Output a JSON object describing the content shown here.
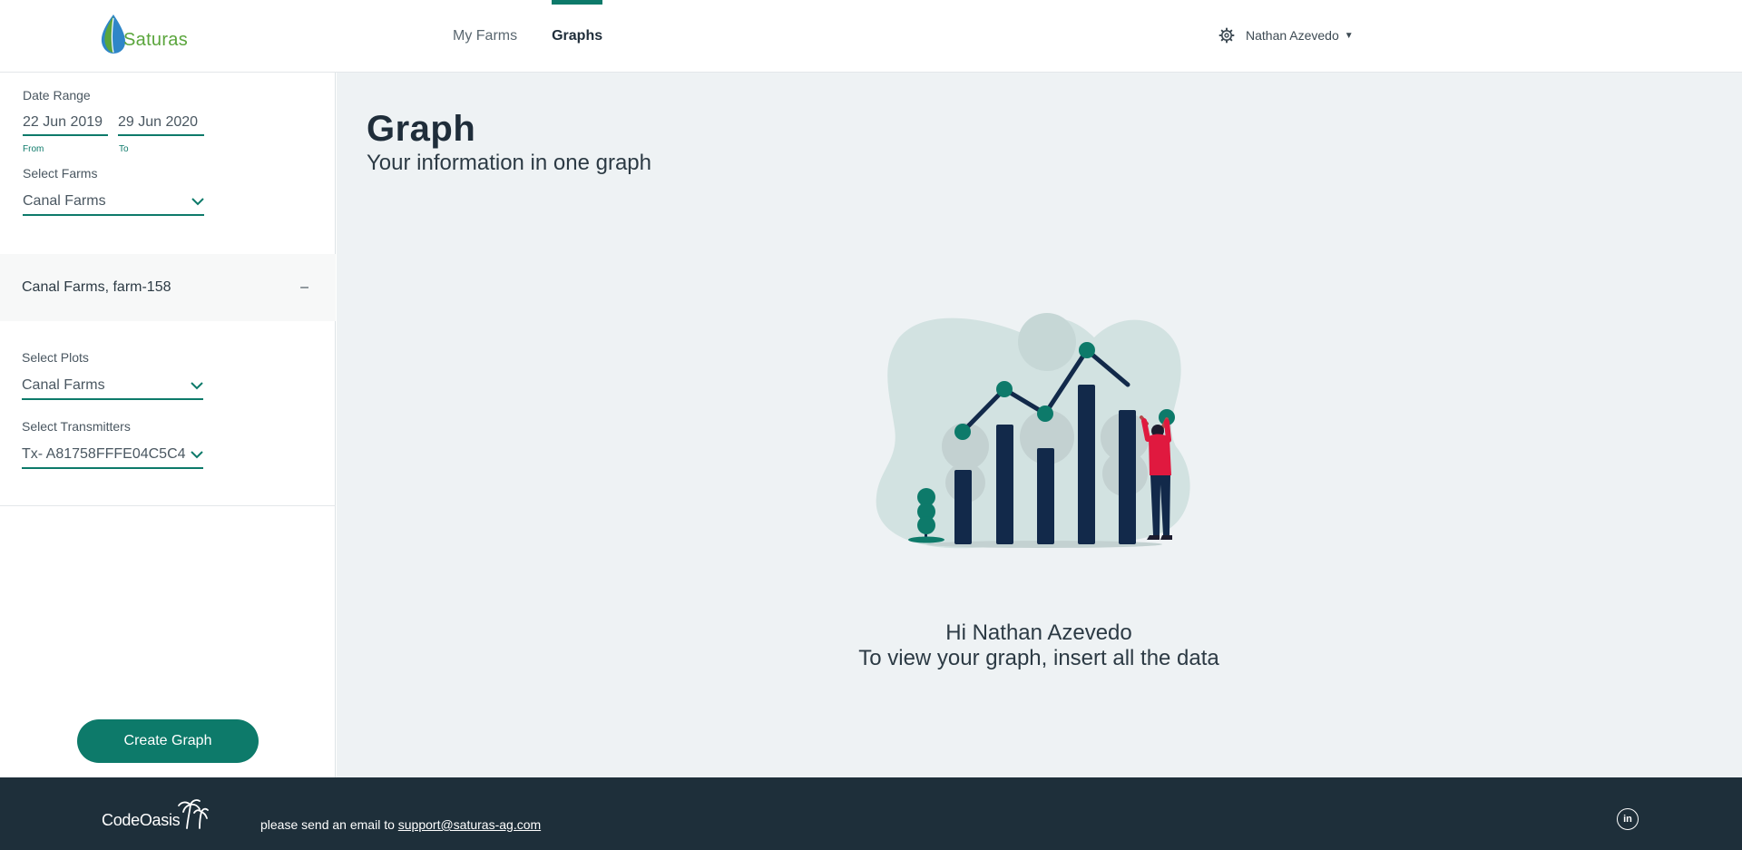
{
  "header": {
    "logo_text": "Saturas",
    "nav": [
      {
        "label": "My Farms",
        "active": false
      },
      {
        "label": "Graphs",
        "active": true
      }
    ],
    "user_name": "Nathan Azevedo"
  },
  "sidebar": {
    "date_range_label": "Date Range",
    "from_value": "22 Jun 2019",
    "from_label": "From",
    "to_value": "29 Jun 2020",
    "to_label": "To",
    "select_farms_label": "Select Farms",
    "select_farms_value": "Canal Farms",
    "farm_panel_title": "Canal Farms, farm-158",
    "farm_panel_toggle": "–",
    "select_plots_label": "Select Plots",
    "select_plots_value": "Canal Farms",
    "select_transmitters_label": "Select Transmitters",
    "select_transmitters_value": "Tx- A81758FFFE04C5C4",
    "create_button": "Create Graph"
  },
  "main": {
    "title": "Graph",
    "subtitle": "Your information in one graph",
    "greeting": "Hi Nathan Azevedo",
    "instruction": "To view your graph, insert all the data"
  },
  "footer": {
    "logo_text": "CodeOasis",
    "contact_prefix": "please send an email to ",
    "contact_email": "support@saturas-ag.com",
    "social_icon": "linkedin-icon"
  },
  "colors": {
    "accent": "#0d7a6a",
    "footer_bg": "#1e2f3a",
    "main_bg": "#eef2f4",
    "logo_green": "#5aa53c"
  }
}
